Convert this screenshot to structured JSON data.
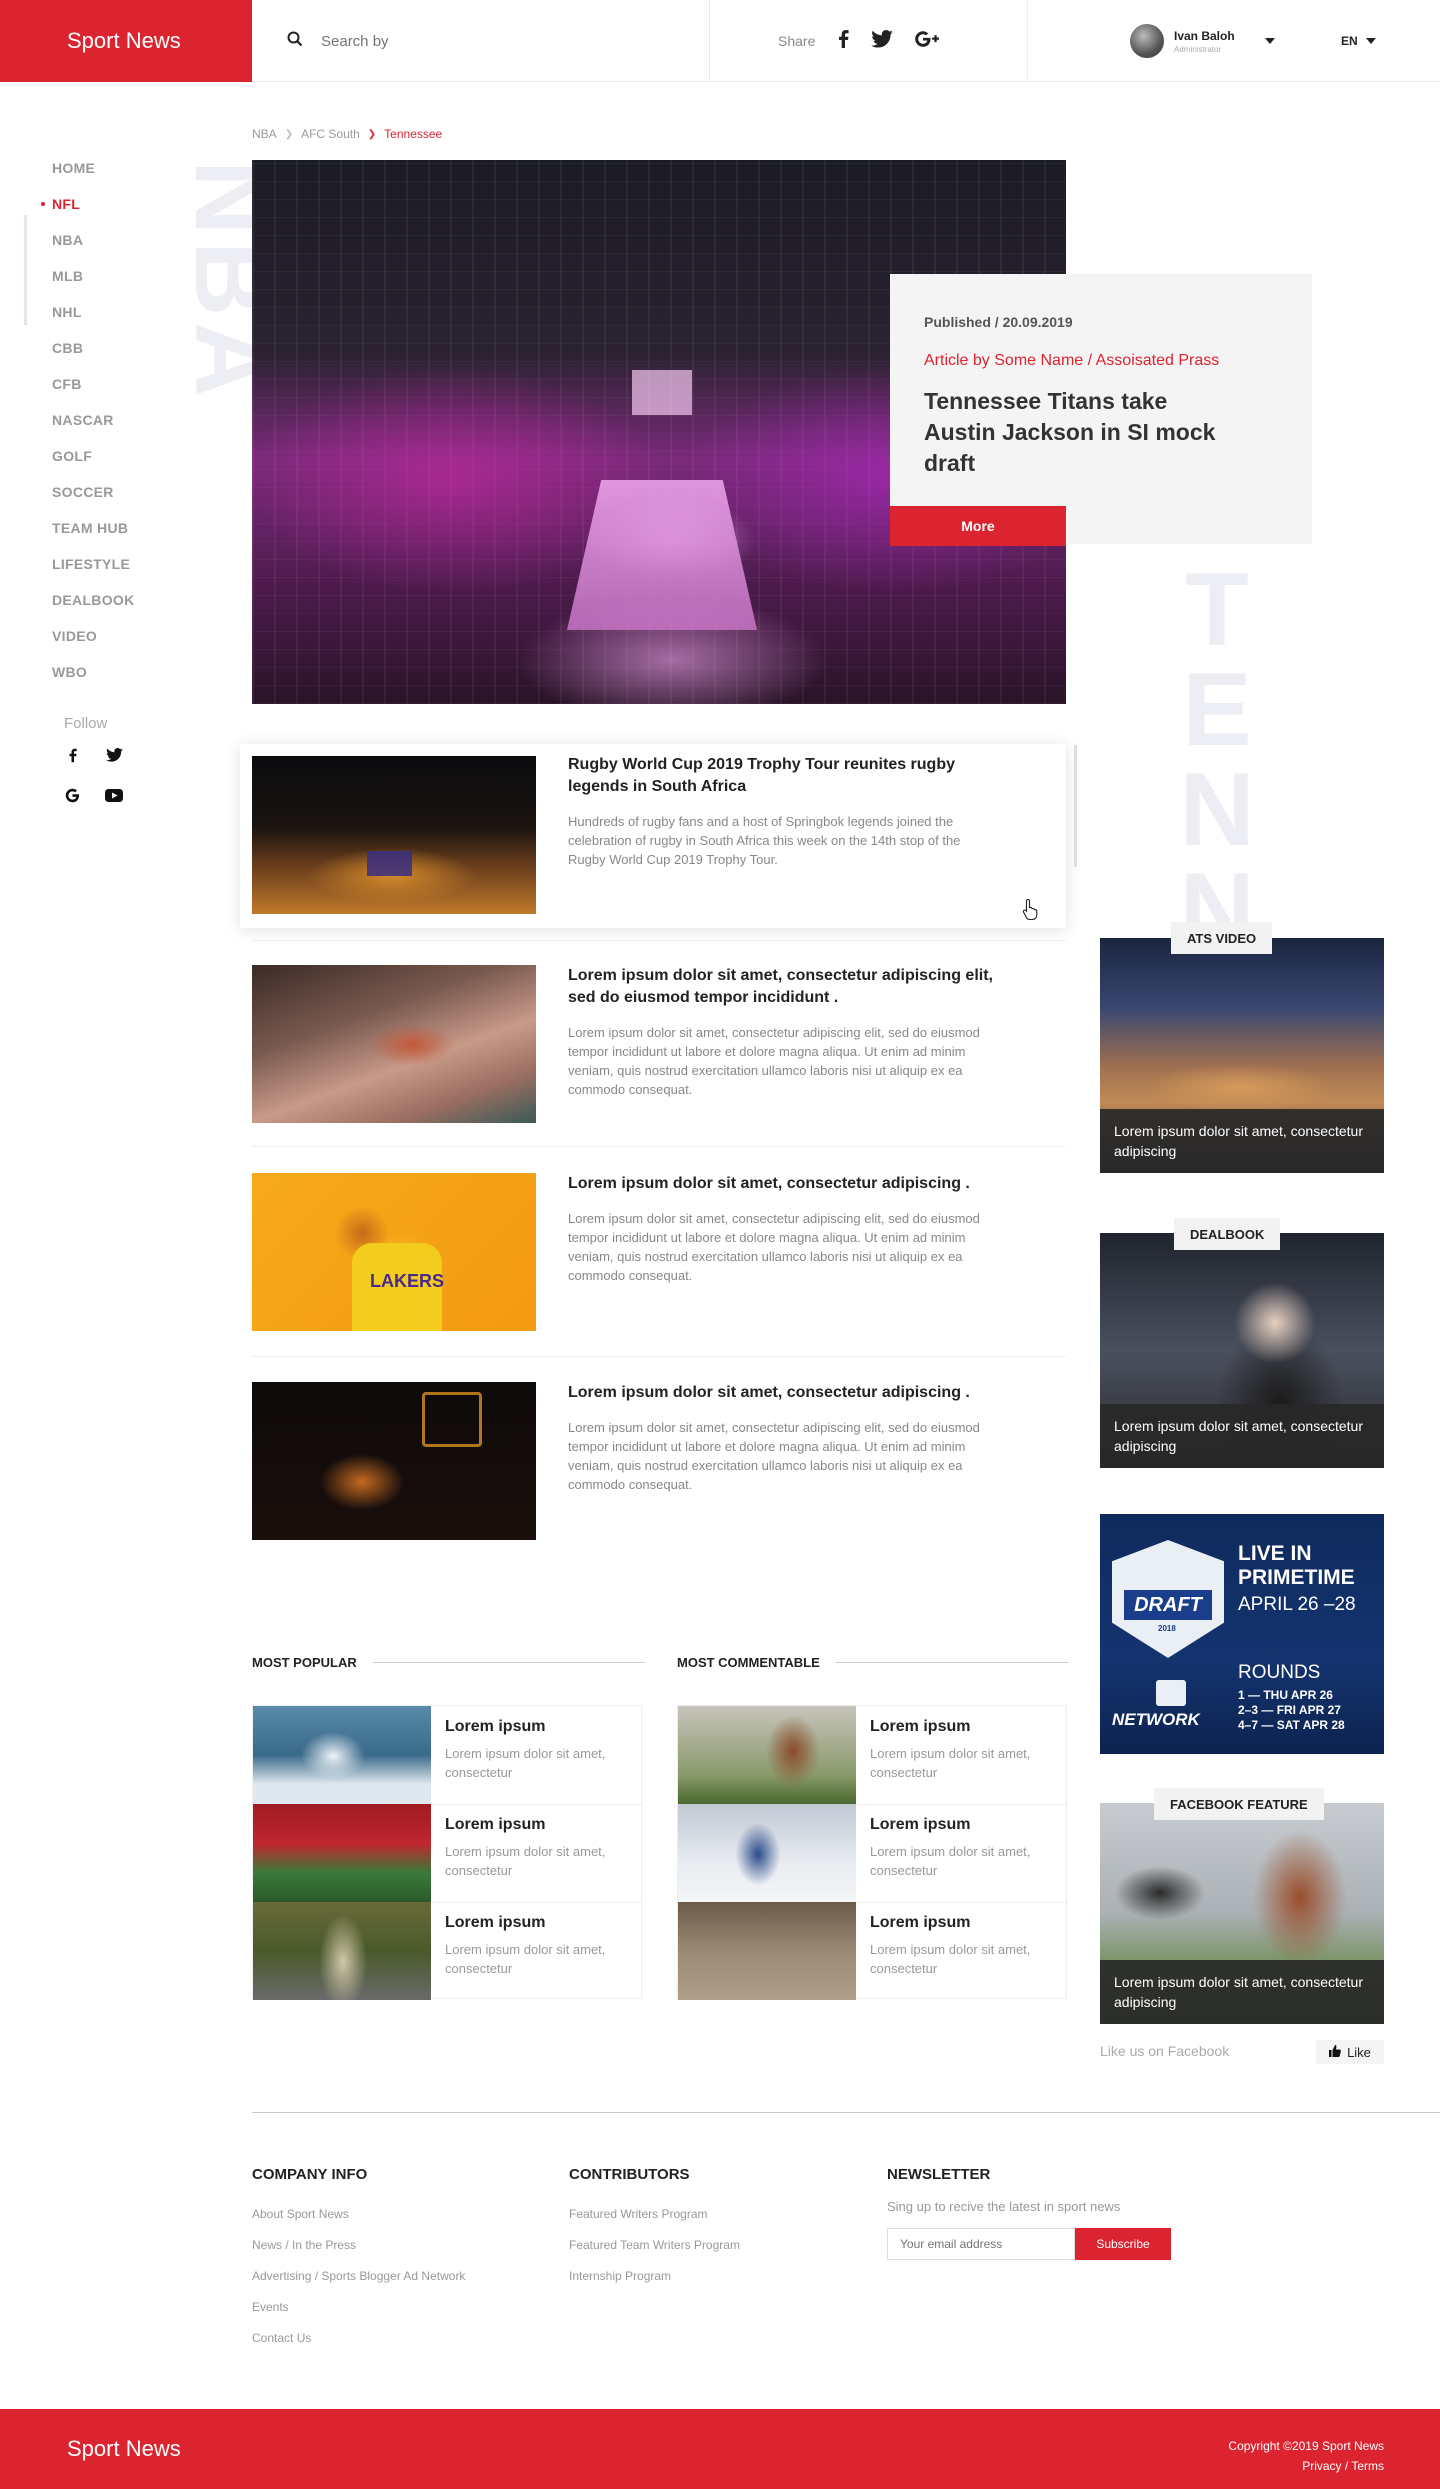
{
  "brand": "Sport News",
  "search": {
    "placeholder": "Search by"
  },
  "share": {
    "label": "Share"
  },
  "user": {
    "name": "Ivan Baloh",
    "role": "Administrator"
  },
  "lang": "EN",
  "sidebar": {
    "items": [
      "HOME",
      "NFL",
      "NBA",
      "MLB",
      "NHL",
      "CBB",
      "CFB",
      "NASCAR",
      "GOLF",
      "SOCCER",
      "TEAM HUB",
      "LIFESTYLE",
      "DEALBOOK",
      "VIDEO",
      "WBO"
    ],
    "active": "NFL",
    "follow_label": "Follow"
  },
  "watermarks": {
    "left": "NBA",
    "right": "TENNE"
  },
  "breadcrumb": [
    "NBA",
    "AFC South",
    "Tennessee"
  ],
  "hero": {
    "published": "Published / 20.09.2019",
    "author": "Article by Some Name / Assoisated Prass",
    "title": "Tennessee Titans take Austin Jackson in SI mock draft",
    "more": "More"
  },
  "articles": [
    {
      "title": "Rugby World Cup 2019 Trophy Tour reunites rugby legends in South Africa",
      "desc": "Hundreds of rugby fans and a host of Springbok legends joined the celebration of rugby in South Africa this week on the 14th stop of the Rugby World Cup 2019 Trophy Tour."
    },
    {
      "title": "Lorem ipsum dolor sit amet, consectetur adipiscing elit, sed do eiusmod tempor incididunt .",
      "desc": "Lorem ipsum dolor sit amet, consectetur adipiscing elit, sed do eiusmod tempor incididunt ut labore et dolore magna aliqua. Ut enim ad minim veniam, quis nostrud exercitation ullamco laboris nisi ut aliquip ex ea commodo consequat."
    },
    {
      "title": "Lorem ipsum dolor sit amet, consectetur adipiscing .",
      "desc": "Lorem ipsum dolor sit amet, consectetur adipiscing elit, sed do eiusmod tempor incididunt ut labore et dolore magna aliqua. Ut enim ad minim veniam, quis nostrud exercitation ullamco laboris nisi ut aliquip ex ea commodo consequat."
    },
    {
      "title": "Lorem ipsum dolor sit amet, consectetur adipiscing .",
      "desc": "Lorem ipsum dolor sit amet, consectetur adipiscing elit, sed do eiusmod tempor incididunt ut labore et dolore magna aliqua. Ut enim ad minim veniam, quis nostrud exercitation ullamco laboris nisi ut aliquip ex ea commodo consequat."
    }
  ],
  "right": {
    "ats": {
      "tag": "ATS VIDEO",
      "caption": "Lorem ipsum dolor sit amet, consectetur adipiscing"
    },
    "dealbook": {
      "tag": "DEALBOOK",
      "caption": "Lorem ipsum dolor sit amet, consectetur adipiscing"
    },
    "ad": {
      "logo": "DRAFT",
      "year": "2018",
      "line1": "LIVE IN",
      "line2": "PRIMETIME",
      "dates": "APRIL 26 –28",
      "rounds": "ROUNDS",
      "r1": "1 — THU APR 26",
      "r2": "2–3 — FRI APR 27",
      "r3": "4–7 — SAT APR 28",
      "network": "NETWORK"
    },
    "facebook": {
      "tag": "FACEBOOK FEATURE",
      "caption": "Lorem ipsum dolor sit amet, consectetur adipiscing",
      "like_text": "Like us on Facebook",
      "like_btn": "Like"
    }
  },
  "most_popular": {
    "title": "MOST POPULAR",
    "items": [
      {
        "h": "Lorem ipsum",
        "s": "Lorem ipsum dolor sit amet, consectetur"
      },
      {
        "h": "Lorem ipsum",
        "s": "Lorem ipsum dolor sit amet, consectetur"
      },
      {
        "h": "Lorem ipsum",
        "s": "Lorem ipsum dolor sit amet, consectetur"
      }
    ]
  },
  "most_commentable": {
    "title": "MOST COMMENTABLE",
    "items": [
      {
        "h": "Lorem ipsum",
        "s": "Lorem ipsum dolor sit amet, consectetur"
      },
      {
        "h": "Lorem ipsum",
        "s": "Lorem ipsum dolor sit amet, consectetur"
      },
      {
        "h": "Lorem ipsum",
        "s": "Lorem ipsum dolor sit amet, consectetur"
      }
    ]
  },
  "footer": {
    "company": {
      "title": "COMPANY INFO",
      "links": [
        "About Sport News",
        "News / In the Press",
        "Advertising / Sports Blogger Ad Network",
        "Events",
        "Contact Us"
      ]
    },
    "contributors": {
      "title": "CONTRIBUTORS",
      "links": [
        "Featured Writers Program",
        "Featured Team Writers Program",
        "Internship Program"
      ]
    },
    "newsletter": {
      "title": "NEWSLETTER",
      "desc": "Sing up to recive the latest in sport news",
      "placeholder": "Your email address",
      "button": "Subscribe"
    },
    "brand": "Sport News",
    "copyright": "Copyright ©2019 Sport News",
    "legal": "Privacy / Terms"
  },
  "colors": {
    "accent": "#dc2430"
  }
}
